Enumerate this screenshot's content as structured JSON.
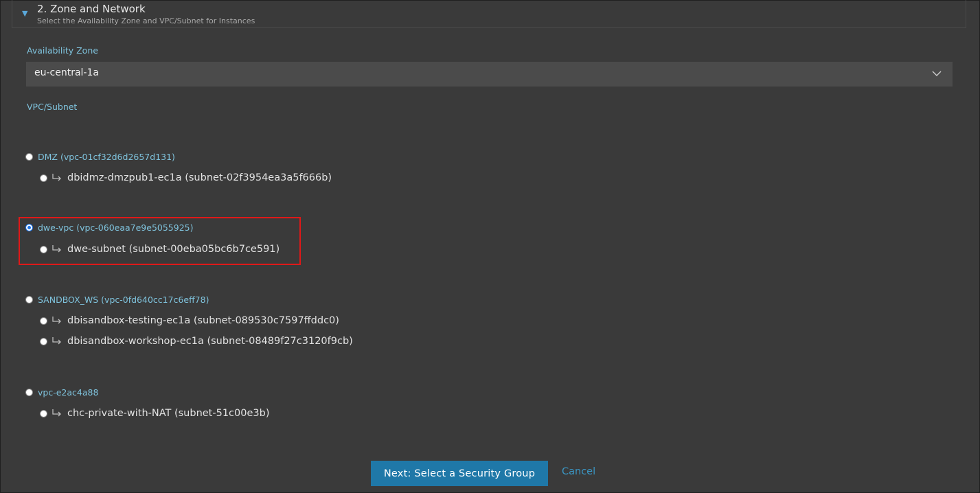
{
  "section": {
    "title": "2. Zone and Network",
    "subtitle": "Select the Availability Zone and VPC/Subnet for Instances"
  },
  "availability_zone": {
    "label": "Availability Zone",
    "selected": "eu-central-1a"
  },
  "vpc_subnet": {
    "label": "VPC/Subnet",
    "vpcs": [
      {
        "label": "DMZ (vpc-01cf32d6d2657d131)",
        "selected": false,
        "subnets": [
          {
            "label": "dbidmz-dmzpub1-ec1a (subnet-02f3954ea3a5f666b)",
            "selected": false
          }
        ]
      },
      {
        "label": "dwe-vpc (vpc-060eaa7e9e5055925)",
        "selected": true,
        "subnets": [
          {
            "label": "dwe-subnet (subnet-00eba05bc6b7ce591)",
            "selected": false
          }
        ]
      },
      {
        "label": "SANDBOX_WS (vpc-0fd640cc17c6eff78)",
        "selected": false,
        "subnets": [
          {
            "label": "dbisandbox-testing-ec1a (subnet-089530c7597ffddc0)",
            "selected": false
          },
          {
            "label": "dbisandbox-workshop-ec1a (subnet-08489f27c3120f9cb)",
            "selected": false
          }
        ]
      },
      {
        "label": "vpc-e2ac4a88",
        "selected": false,
        "subnets": [
          {
            "label": "chc-private-with-NAT (subnet-51c00e3b)",
            "selected": false
          }
        ]
      }
    ]
  },
  "actions": {
    "next_label": "Next: Select a Security Group",
    "cancel_label": "Cancel"
  },
  "colors": {
    "background": "#3a3a3a",
    "accent": "#7fc3dd",
    "primary_button": "#1f78a8",
    "highlight": "#e01818"
  },
  "icons": {
    "caret": "caret-down-icon",
    "chevron": "chevron-down-icon",
    "subnet_arrow": "return-arrow-icon"
  }
}
